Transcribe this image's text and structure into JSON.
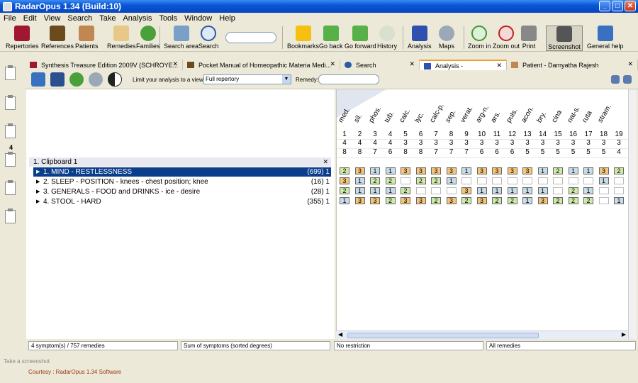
{
  "window": {
    "title": "RadarOpus 1.34 (Build:10)"
  },
  "menu": [
    "File",
    "Edit",
    "View",
    "Search",
    "Take",
    "Analysis",
    "Tools",
    "Window",
    "Help"
  ],
  "toolbar": [
    "Repertories",
    "References",
    "Patients",
    "Remedies",
    "Families",
    "Search area",
    "Search",
    "Bookmarks",
    "Go back",
    "Go forward",
    "History",
    "Analysis",
    "Maps",
    "Zoom in",
    "Zoom out",
    "Print",
    "Screenshot",
    "General help"
  ],
  "leftstrip": {
    "count": "4"
  },
  "tabs": [
    {
      "label": "Synthesis Treasure Edition 2009V (SCHROYE...",
      "close": "✕"
    },
    {
      "label": "Pocket Manual of Homeopathic Materia Medi...",
      "close": "✕"
    },
    {
      "label": "Search",
      "close": "✕"
    },
    {
      "label": "Analysis -",
      "close": "✕"
    },
    {
      "label": "Patient - Damyatha Rajesh",
      "close": "✕"
    }
  ],
  "analysis_toolbar": {
    "limit_label": "Limit your analysis to a view:",
    "view_value": "Full repertory",
    "remedy_label": "Remedy:",
    "remedy_value": ""
  },
  "clipboard": {
    "title": "1. Clipboard 1",
    "close": "✕"
  },
  "rubrics": [
    {
      "label": "1. MIND - RESTLESSNESS",
      "count": "(699) 1"
    },
    {
      "label": "2. SLEEP - POSITION - knees - chest position; knee",
      "count": "(16) 1"
    },
    {
      "label": "3. GENERALS - FOOD and DRINKS - ice - desire",
      "count": "(28) 1"
    },
    {
      "label": "4. STOOL - HARD",
      "count": "(355) 1"
    }
  ],
  "remedies": [
    "med.",
    "sil.",
    "phos.",
    "tub.",
    "calc.",
    "lyc.",
    "calc-p.",
    "sep.",
    "verat.",
    "arg-n.",
    "ars.",
    "puls.",
    "acon.",
    "bry.",
    "cina",
    "nat-s.",
    "ruta",
    "stram."
  ],
  "rank": [
    "1",
    "2",
    "3",
    "4",
    "5",
    "6",
    "7",
    "8",
    "9",
    "10",
    "11",
    "12",
    "13",
    "14",
    "15",
    "16",
    "17",
    "18",
    "19"
  ],
  "hits": [
    "4",
    "4",
    "4",
    "4",
    "3",
    "3",
    "3",
    "3",
    "3",
    "3",
    "3",
    "3",
    "3",
    "3",
    "3",
    "3",
    "3",
    "3",
    "3"
  ],
  "scores": [
    "8",
    "8",
    "7",
    "6",
    "8",
    "8",
    "7",
    "7",
    "7",
    "6",
    "6",
    "6",
    "5",
    "5",
    "5",
    "5",
    "5",
    "5",
    "4"
  ],
  "grid": [
    [
      "2",
      "3",
      "1",
      "1",
      "3",
      "3",
      "3",
      "3",
      "1",
      "3",
      "3",
      "3",
      "3",
      "1",
      "2",
      "1",
      "1",
      "3",
      "2"
    ],
    [
      "3",
      "1",
      "2",
      "2",
      "",
      "2",
      "2",
      "1",
      "",
      "",
      "",
      "",
      "",
      "",
      "",
      "",
      "",
      "1",
      ""
    ],
    [
      "2",
      "1",
      "1",
      "1",
      "2",
      "",
      "",
      "",
      "3",
      "1",
      "1",
      "1",
      "1",
      "1",
      "",
      "2",
      "1",
      "",
      ""
    ],
    [
      "1",
      "3",
      "3",
      "2",
      "3",
      "3",
      "2",
      "3",
      "2",
      "3",
      "2",
      "2",
      "1",
      "3",
      "2",
      "2",
      "2",
      "",
      "1"
    ]
  ],
  "status": {
    "count": "4 symptom(s) / 757 remedies",
    "sort": "Sum of symptoms (sorted degrees)",
    "restriction": "No restriction",
    "remedies": "All remedies"
  },
  "hint": "Take a screenshot",
  "courtesy": "Courtesy : RadarOpus 1.34 Software"
}
